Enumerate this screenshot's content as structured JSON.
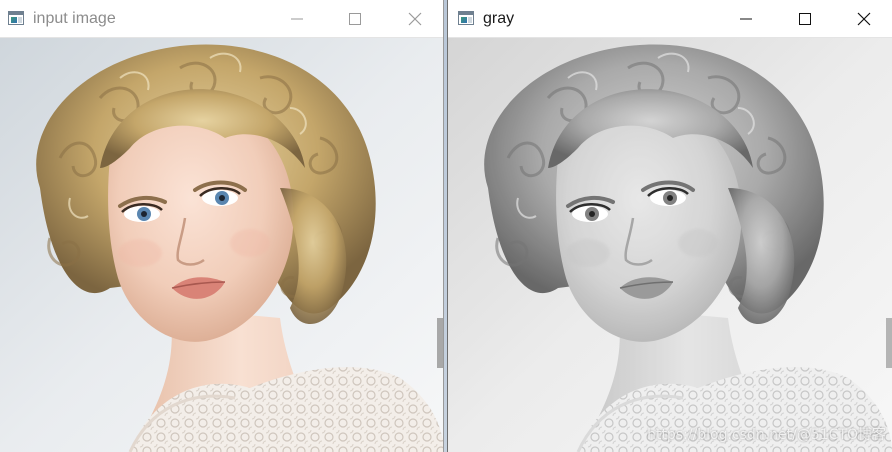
{
  "windows": [
    {
      "title": "input image",
      "state": "inactive",
      "content": "color-portrait-image",
      "icon": "app-window-icon",
      "controls": [
        "minimize-icon",
        "maximize-icon",
        "close-icon"
      ]
    },
    {
      "title": "gray",
      "state": "active",
      "content": "grayscale-portrait-image",
      "icon": "app-window-icon",
      "controls": [
        "minimize-icon",
        "maximize-icon",
        "close-icon"
      ]
    }
  ],
  "watermark": "https://blog.csdn.net/@51CTO博客",
  "colors": {
    "inactive_title": "#8c8c8c",
    "active_title": "#1a1a1a",
    "titlebar_bg": "#ffffff",
    "desktop_bg": "#c9d6e4"
  }
}
